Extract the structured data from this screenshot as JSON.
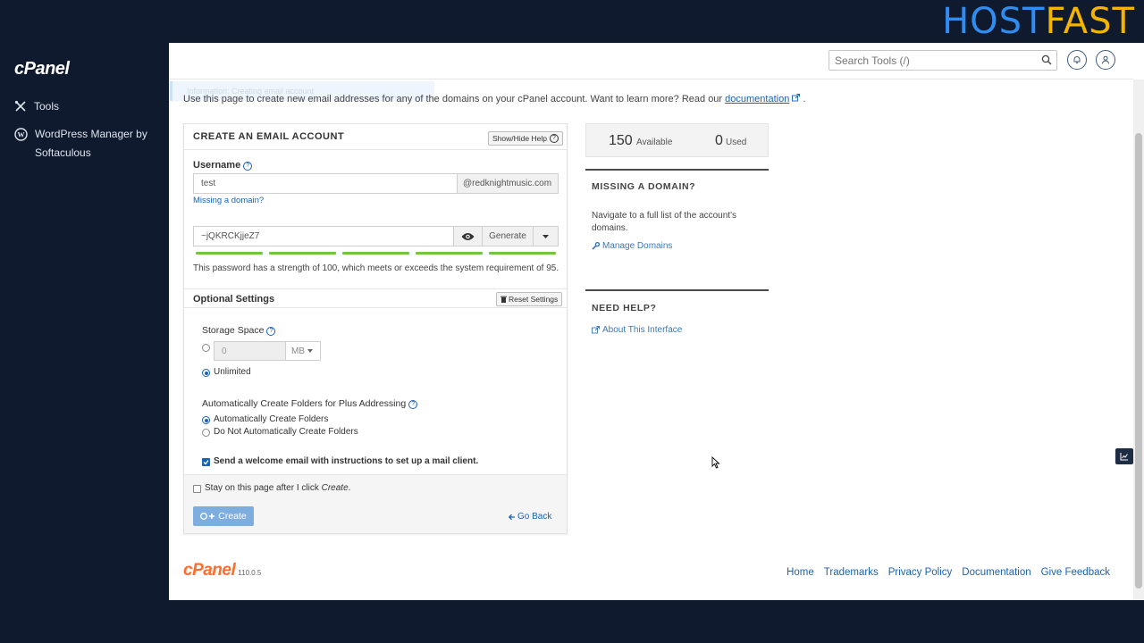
{
  "brand": {
    "part1": "HOST",
    "part2": "FAST"
  },
  "sidebar": {
    "logo": "cPanel",
    "items": [
      {
        "label": "Tools",
        "icon": "tools-icon"
      },
      {
        "label": "WordPress Manager by Softaculous",
        "icon": "wordpress-icon"
      }
    ]
  },
  "header": {
    "search_placeholder": "Search Tools (/)"
  },
  "notice": {
    "ghost_text": "Information: Creating email account"
  },
  "intro": {
    "text": "Use this page to create new email addresses for any of the domains on your cPanel account. Want to learn more? Read our",
    "link": "documentation",
    "end": "."
  },
  "form": {
    "title": "CREATE AN EMAIL ACCOUNT",
    "show_hide_help": "Show/Hide Help",
    "username_label": "Username",
    "username_value": "test",
    "domain_suffix": "@redknightmusic.com",
    "missing_domain": "Missing a domain?",
    "password_value": "~jQKRCKjjeZ7",
    "generate_label": "Generate",
    "strength_percent": 100,
    "strength_note": "This password has a strength of 100, which meets or exceeds the system requirement of 95.",
    "optional_title": "Optional Settings",
    "reset_settings": "Reset Settings",
    "storage_label": "Storage Space",
    "storage_value": "0",
    "storage_unit": "MB",
    "unlimited_label": "Unlimited",
    "plus_label": "Automatically Create Folders for Plus Addressing",
    "plus_opt1": "Automatically Create Folders",
    "plus_opt2": "Do Not Automatically Create Folders",
    "welcome_label": "Send a welcome email with instructions to set up a mail client.",
    "stay_label_pre": "Stay on this page after I click ",
    "stay_label_em": "Create",
    "stay_label_post": ".",
    "create_label": "Create",
    "go_back": "Go Back"
  },
  "stats": {
    "available_num": "150",
    "available_label": "Available",
    "used_num": "0",
    "used_label": "Used"
  },
  "missing_domain_box": {
    "title": "MISSING A DOMAIN?",
    "text": "Navigate to a full list of the account's domains.",
    "link": "Manage Domains"
  },
  "need_help_box": {
    "title": "NEED HELP?",
    "link": "About This Interface"
  },
  "footer": {
    "logo": "cPanel",
    "version": "110.0.5",
    "links": [
      "Home",
      "Trademarks",
      "Privacy Policy",
      "Documentation",
      "Give Feedback"
    ]
  },
  "colors": {
    "accent": "#1b62b3",
    "strength": "#73c53c",
    "brand_blue": "#2f8cf0",
    "brand_yellow": "#f5b400"
  }
}
